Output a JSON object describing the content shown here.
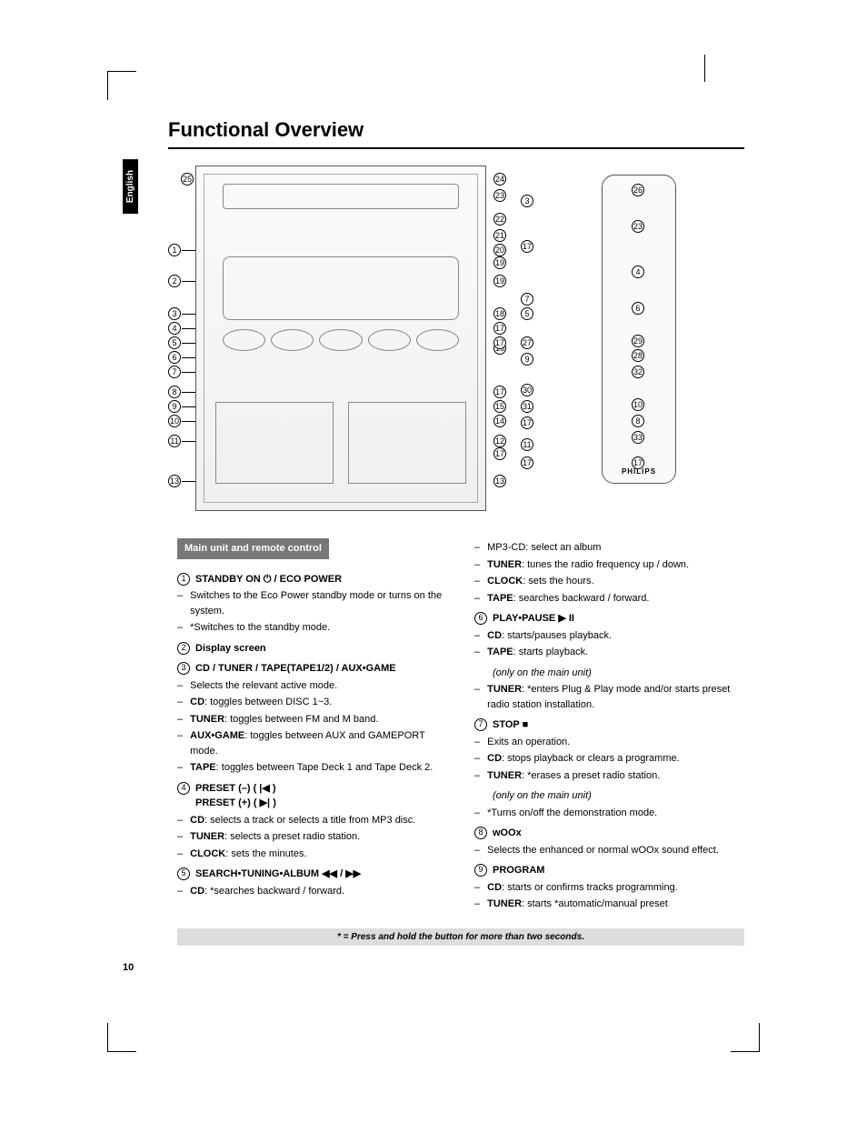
{
  "title": "Functional Overview",
  "lang_tab": "English",
  "section_bar": "Main unit and remote control",
  "remote_brand": "PHILIPS",
  "footnote": "* = Press and hold the button for more than two seconds.",
  "page_number": "10",
  "callouts_left": [
    "1",
    "2",
    "3",
    "4",
    "5",
    "6",
    "7",
    "8",
    "9",
    "10",
    "11",
    "13"
  ],
  "callouts_mid": [
    "24",
    "23",
    "22",
    "21",
    "20",
    "19",
    "19",
    "18",
    "17",
    "16",
    "15",
    "14",
    "12",
    "13",
    "17",
    "17",
    "17"
  ],
  "callouts_right_l": [
    "3",
    "17",
    "7",
    "5",
    "27",
    "9",
    "30",
    "31",
    "17",
    "11",
    "17"
  ],
  "callouts_right_r": [
    "26",
    "23",
    "4",
    "6",
    "29",
    "28",
    "32",
    "10",
    "8",
    "33",
    "17"
  ],
  "callout_25": "25",
  "left_col": [
    {
      "num": "1",
      "heading": "STANDBY ON ⏻ / ECO POWER",
      "subs": [
        "Switches to the Eco Power standby mode or turns on the system.",
        "*Switches to the standby mode."
      ]
    },
    {
      "num": "2",
      "heading": "Display screen",
      "subs": []
    },
    {
      "num": "3",
      "heading": "CD / TUNER / TAPE(TAPE1/2) / AUX•GAME",
      "subs": [
        "Selects the relevant active mode.",
        "<b>CD</b>: toggles between DISC 1~3.",
        "<b>TUNER</b>: toggles between FM and M band.",
        "<b>AUX•GAME</b>: toggles between AUX and GAMEPORT mode.",
        "<b>TAPE</b>: toggles between Tape Deck 1 and Tape Deck 2."
      ]
    },
    {
      "num": "4",
      "heading": "PRESET (–) ( <span class='icon'>|◀</span> )<br>PRESET (+) ( <span class='icon'>▶|</span> )",
      "subs": [
        "<b>CD</b>: selects a track or selects a title from MP3 disc.",
        "<b>TUNER</b>: selects a preset radio station.",
        "<b>CLOCK</b>:  sets the minutes."
      ]
    },
    {
      "num": "5",
      "heading": "SEARCH•TUNING•ALBUM <span class='icon'>◀◀</span> / <span class='icon'>▶▶</span>",
      "subs": [
        "<b>CD</b>: *searches backward / forward."
      ]
    }
  ],
  "right_col_pre": [
    "MP3-CD: select an album",
    "<b>TUNER</b>: tunes the radio frequency up / down.",
    "<b>CLOCK</b>: sets the hours.",
    "<b>TAPE</b>: searches backward / forward."
  ],
  "right_col": [
    {
      "num": "6",
      "heading": "PLAY•PAUSE <span class='icon'>▶</span> <span class='icon'>II</span>",
      "subs": [
        "<b>CD</b>: starts/pauses playback.",
        "<b>TAPE</b>: starts playback."
      ],
      "note": "(only on the main unit)",
      "post_subs": [
        "<b>TUNER</b>: *enters Plug & Play mode and/or starts preset radio station installation."
      ]
    },
    {
      "num": "7",
      "heading": "STOP <span class='icon'>■</span>",
      "subs": [
        "Exits an operation.",
        "<b>CD</b>: stops playback or clears a programme.",
        "<b>TUNER</b>: *erases a preset radio station."
      ],
      "note": "(only on the main unit)",
      "post_subs": [
        "*Turns on/off the demonstration mode."
      ]
    },
    {
      "num": "8",
      "heading": "wOOx",
      "subs": [
        "Selects the enhanced or normal wOOx sound effect."
      ]
    },
    {
      "num": "9",
      "heading": "PROGRAM",
      "subs": [
        "<b>CD</b>: starts or confirms tracks programming.",
        "<b>TUNER</b>: starts *automatic/manual preset"
      ]
    }
  ]
}
